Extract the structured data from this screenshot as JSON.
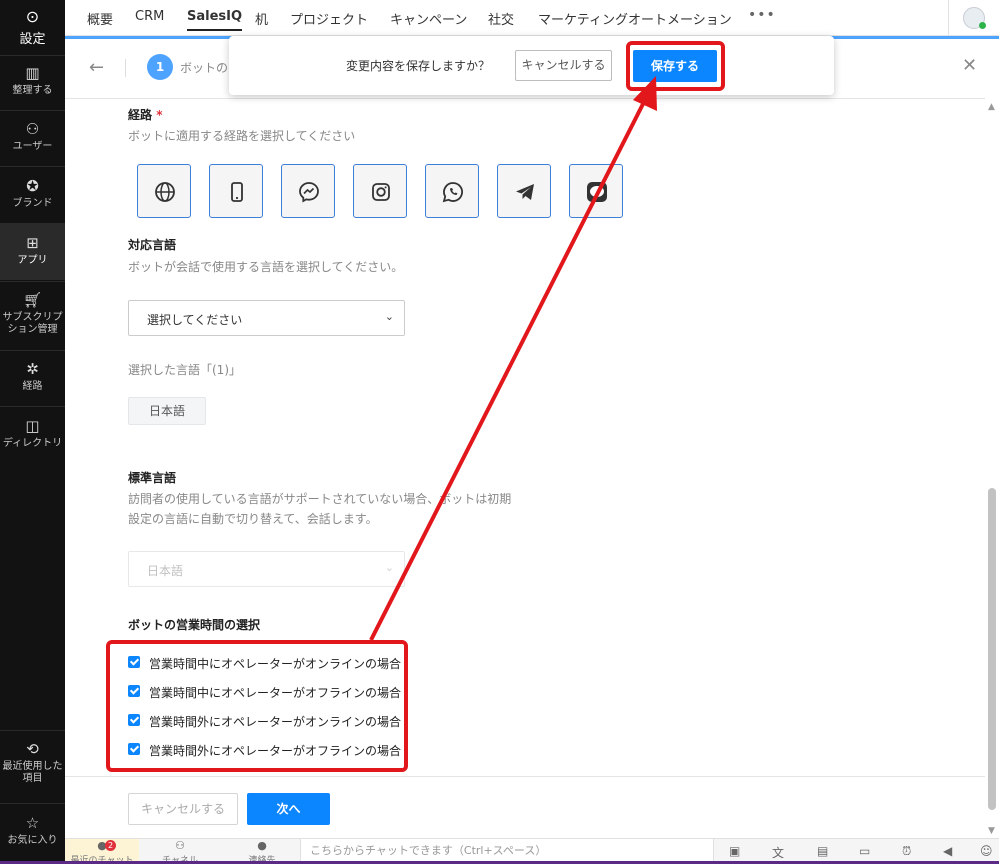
{
  "sidebar": {
    "header": {
      "back_icon": "back-circle-icon",
      "title": "設定"
    },
    "items": [
      {
        "label": "整理する",
        "icon": "organize-icon"
      },
      {
        "label": "ユーザー",
        "icon": "users-icon"
      },
      {
        "label": "ブランド",
        "icon": "brand-icon"
      },
      {
        "label": "アプリ",
        "icon": "apps-icon",
        "active": true
      },
      {
        "label": "サブスクリプション管理",
        "icon": "cart-icon"
      },
      {
        "label": "経路",
        "icon": "channels-icon"
      },
      {
        "label": "ディレクトリ",
        "icon": "directory-icon"
      }
    ],
    "bottom_items": [
      {
        "label": "最近使用した項目",
        "icon": "history-icon"
      },
      {
        "label": "お気に入り",
        "icon": "star-icon"
      }
    ]
  },
  "topnav": {
    "tabs": [
      "概要",
      "CRM",
      "SalesIQ",
      "机",
      "プロジェクト",
      "キャンペーン",
      "社交",
      "マーケティングオートメーション"
    ],
    "active_tab": "SalesIQ",
    "more": "•••"
  },
  "header": {
    "step_number": "1",
    "step_label": "ボットの"
  },
  "popup": {
    "message": "変更内容を保存しますか？",
    "cancel_label": "キャンセルする",
    "save_label": "保存する"
  },
  "form": {
    "channels": {
      "label": "経路",
      "required_mark": "*",
      "description": "ボットに適用する経路を選択してください",
      "icons": [
        "globe-icon",
        "mobile-icon",
        "messenger-icon",
        "instagram-icon",
        "whatsapp-icon",
        "telegram-icon",
        "line-icon"
      ]
    },
    "language": {
      "label": "対応言語",
      "description": "ボットが会話で使用する言語を選択してください。",
      "select_placeholder": "選択してください",
      "selected_caption": "選択した言語「(1)」",
      "selected_chip": "日本語"
    },
    "default_language": {
      "label": "標準言語",
      "description_line1": "訪問者の使用している言語がサポートされていない場合、ボットは初期",
      "description_line2": "設定の言語に自動で切り替えて、会話します。",
      "value": "日本語"
    },
    "business_hours": {
      "label": "ボットの営業時間の選択",
      "options": [
        {
          "label": "営業時間中にオペレーターがオンラインの場合",
          "checked": true
        },
        {
          "label": "営業時間中にオペレーターがオフラインの場合",
          "checked": true
        },
        {
          "label": "営業時間外にオペレーターがオンラインの場合",
          "checked": true
        },
        {
          "label": "営業時間外にオペレーターがオフラインの場合",
          "checked": true
        }
      ]
    }
  },
  "footer": {
    "cancel_label": "キャンセルする",
    "next_label": "次へ"
  },
  "bottombar": {
    "tabs": [
      {
        "label": "最近のチャット",
        "badge": "2",
        "icon": "chat-icon"
      },
      {
        "label": "チャネル",
        "icon": "group-icon"
      },
      {
        "label": "連絡先",
        "icon": "contact-icon"
      }
    ],
    "chat_placeholder": "こちらからチャットできます（Ctrl+スペース）"
  },
  "colors": {
    "accent": "#0c86ff",
    "annotation": "#e2171c",
    "sidebar_bg": "#121212"
  }
}
